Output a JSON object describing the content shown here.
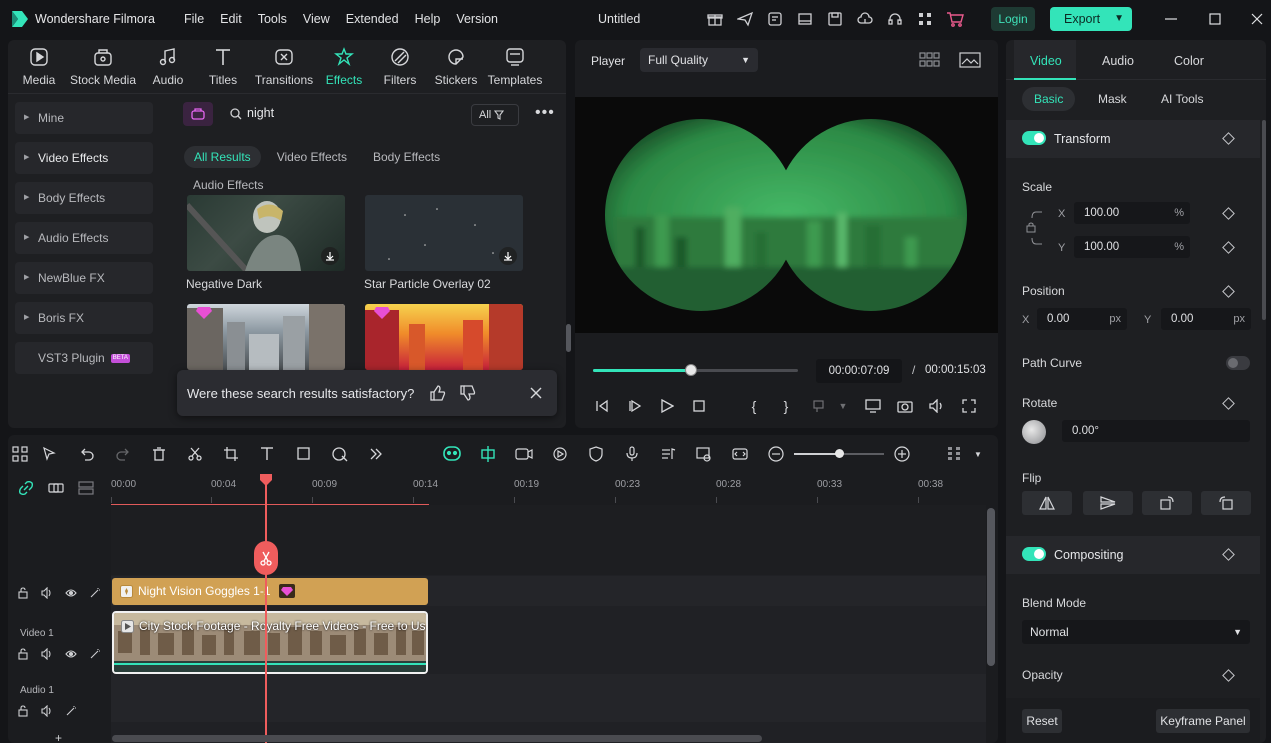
{
  "app": {
    "name": "Wondershare Filmora",
    "document_title": "Untitled",
    "menu": [
      "File",
      "Edit",
      "Tools",
      "View",
      "Extended",
      "Help",
      "Version"
    ],
    "login_label": "Login",
    "export_label": "Export",
    "accent": "#33e4b9"
  },
  "media": {
    "tabs": [
      {
        "label": "Media",
        "icon": "media-icon"
      },
      {
        "label": "Stock Media",
        "icon": "stock-media-icon"
      },
      {
        "label": "Audio",
        "icon": "music-note-icon"
      },
      {
        "label": "Titles",
        "icon": "title-t-icon"
      },
      {
        "label": "Transitions",
        "icon": "transitions-icon"
      },
      {
        "label": "Effects",
        "icon": "effects-icon",
        "active": true
      },
      {
        "label": "Filters",
        "icon": "filters-icon"
      },
      {
        "label": "Stickers",
        "icon": "stickers-icon"
      },
      {
        "label": "Templates",
        "icon": "templates-icon"
      }
    ],
    "categories": [
      "Mine",
      "Video Effects",
      "Body Effects",
      "Audio Effects",
      "NewBlue FX",
      "Boris FX",
      "VST3 Plugin"
    ],
    "beta_label": "BETA",
    "search_value": "night",
    "filter_label": "All",
    "result_tabs": [
      "All Results",
      "Video Effects",
      "Body Effects"
    ],
    "section_label": "Audio Effects",
    "results": [
      {
        "label": "Negative Dark"
      },
      {
        "label": "Star Particle Overlay 02"
      },
      {
        "label": ""
      },
      {
        "label": ""
      }
    ],
    "satisfaction_prompt": "Were these search results satisfactory?"
  },
  "player": {
    "label": "Player",
    "quality": "Full Quality",
    "current_time": "00:00:07:09",
    "separator": "/",
    "total_time": "00:00:15:03",
    "progress": 0.48
  },
  "timeline": {
    "ruler": [
      "00:00",
      "00:04",
      "00:09",
      "00:14",
      "00:19",
      "00:23",
      "00:28",
      "00:33",
      "00:38"
    ],
    "tracks": {
      "video1_label": "Video 1",
      "audio1_label": "Audio 1"
    },
    "clips": {
      "effect": "Night Vision Goggles 1-1",
      "video": "City Stock Footage - Royalty Free Videos - Free to Us..."
    },
    "zoom_level": 0.5
  },
  "properties": {
    "tabs": [
      "Video",
      "Audio",
      "Color"
    ],
    "subtabs": [
      "Basic",
      "Mask",
      "AI Tools"
    ],
    "transform": {
      "title": "Transform",
      "scale_label": "Scale",
      "x_label": "X",
      "y_label": "Y",
      "scale_x": "100.00",
      "scale_y": "100.00",
      "percent": "%",
      "position_label": "Position",
      "pos_x": "0.00",
      "pos_y": "0.00",
      "px": "px",
      "path_curve_label": "Path Curve",
      "rotate_label": "Rotate",
      "rotate_value": "0.00°",
      "flip_label": "Flip"
    },
    "compositing": {
      "title": "Compositing",
      "blend_mode_label": "Blend Mode",
      "blend_mode": "Normal",
      "opacity_label": "Opacity"
    },
    "reset_label": "Reset",
    "keyframe_label": "Keyframe Panel"
  }
}
